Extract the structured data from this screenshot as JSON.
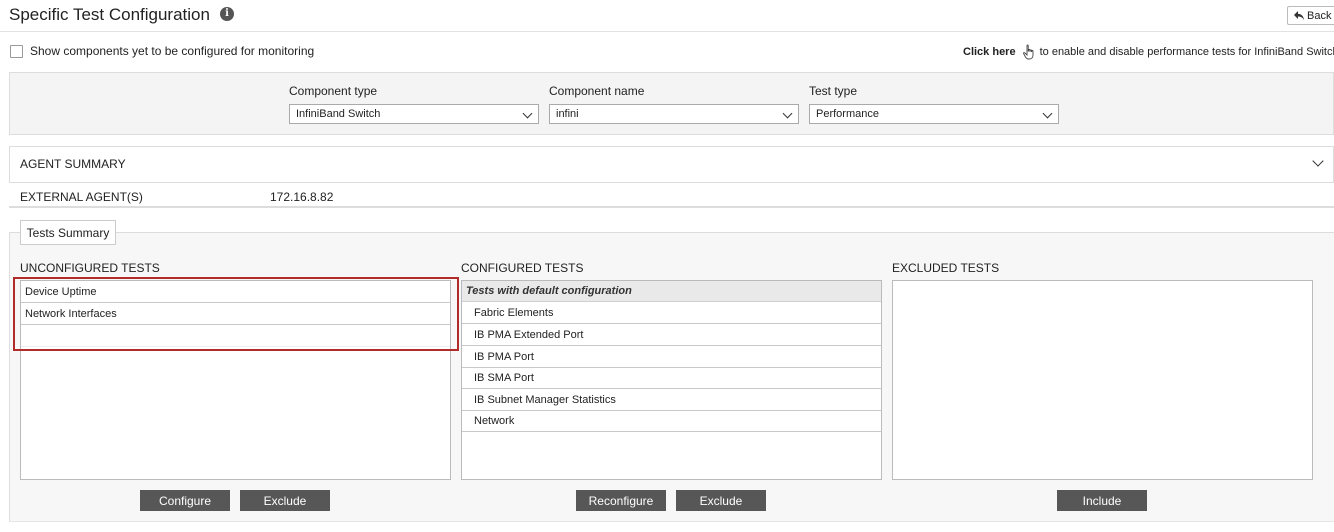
{
  "header": {
    "title": "Specific Test Configuration",
    "info_glyph": "i",
    "back_label": "Back",
    "back_icon": "reply-arrow-icon"
  },
  "options": {
    "show_unconfigured_label": "Show components yet to be configured for monitoring",
    "show_unconfigured_checked": false,
    "click_here_link": "Click here",
    "click_here_text": "to enable and disable performance tests for InfiniBand Switch"
  },
  "filters": {
    "component_type": {
      "label": "Component type",
      "value": "InfiniBand Switch"
    },
    "component_name": {
      "label": "Component name",
      "value": "infini"
    },
    "test_type": {
      "label": "Test type",
      "value": "Performance"
    }
  },
  "agent_summary": {
    "title": "AGENT SUMMARY",
    "external_agents_label": "EXTERNAL AGENT(S)",
    "external_agents_value": "172.16.8.82"
  },
  "tests_summary": {
    "tab_label": "Tests Summary",
    "unconfigured": {
      "title": "UNCONFIGURED TESTS",
      "items": [
        "Device Uptime",
        "Network Interfaces"
      ],
      "buttons": {
        "configure": "Configure",
        "exclude": "Exclude"
      }
    },
    "configured": {
      "title": "CONFIGURED TESTS",
      "group_label": "Tests with default configuration",
      "items": [
        "Fabric Elements",
        "IB PMA Extended Port",
        "IB PMA Port",
        "IB SMA Port",
        "IB Subnet Manager Statistics",
        "Network"
      ],
      "buttons": {
        "reconfigure": "Reconfigure",
        "exclude": "Exclude"
      }
    },
    "excluded": {
      "title": "EXCLUDED TESTS",
      "items": [],
      "buttons": {
        "include": "Include"
      }
    }
  },
  "colors": {
    "highlight_border": "#b22a2a",
    "button_bg": "#575757",
    "panel_bg": "#f4f4f4"
  }
}
